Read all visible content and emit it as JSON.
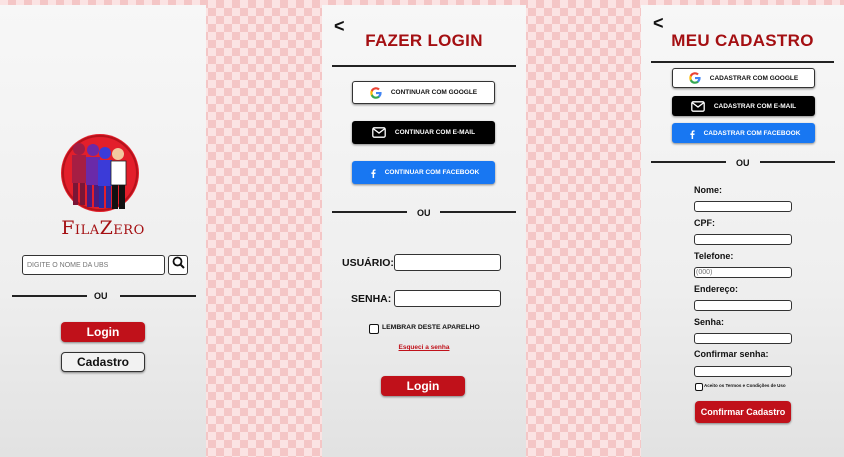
{
  "screen1": {
    "brand": "FilaZero",
    "search": {
      "placeholder": "DIGITE O NOME DA UBS"
    },
    "divider_text": "OU",
    "login_label": "Login",
    "register_label": "Cadastro"
  },
  "screen2": {
    "back": "<",
    "title": "FAZER LOGIN",
    "google_label": "CONTINUAR COM GOOGLE",
    "email_label": "CONTINUAR COM E-MAIL",
    "facebook_label": "CONTINUAR COM FACEBOOK",
    "divider_text": "OU",
    "user_label": "USUÁRIO:",
    "password_label": "SENHA:",
    "remember_label": "LEMBRAR DESTE APARELHO",
    "forgot_label": "Esqueci a senha",
    "login_label": "Login"
  },
  "screen3": {
    "back": "<",
    "title": "MEU CADASTRO",
    "google_label": "CADASTRAR COM GOOGLE",
    "email_label": "CADASTRAR COM E-MAIL",
    "facebook_label": "CADASTRAR COM FACEBOOK",
    "divider_text": "OU",
    "fields": {
      "name_label": "Nome:",
      "cpf_label": "CPF:",
      "phone_label": "Telefone:",
      "phone_placeholder": "(000)",
      "address_label": "Endereço:",
      "password_label": "Senha:",
      "confirm_label": "Confirmar senha:"
    },
    "terms_label": "Aceito os Termos e Condições de Uso",
    "submit_label": "Confirmar Cadastro"
  },
  "colors": {
    "brand_red": "#a40f12",
    "button_red": "#c0111a",
    "facebook_blue": "#1877f2"
  }
}
